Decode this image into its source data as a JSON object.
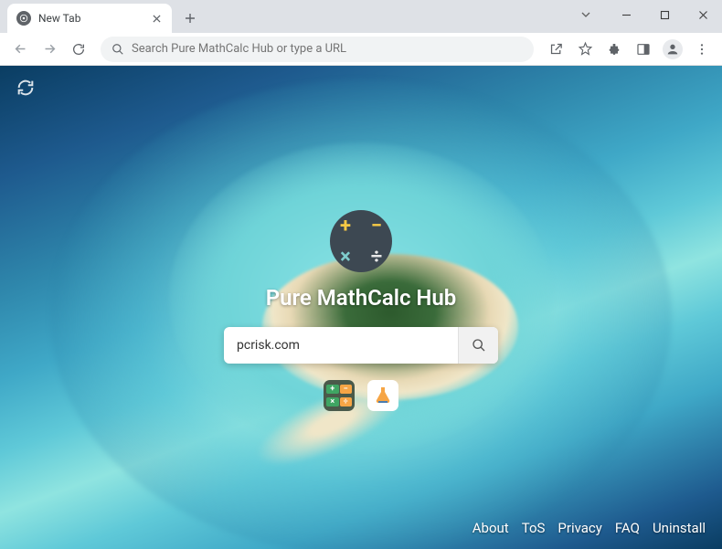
{
  "window": {
    "tab_title": "New Tab"
  },
  "omnibox": {
    "placeholder": "Search Pure MathCalc Hub or type a URL"
  },
  "page": {
    "brand": "Pure MathCalc Hub",
    "search_value": "pcrisk.com",
    "logo_symbols": {
      "plus": "+",
      "minus": "−",
      "times": "×",
      "div": "÷"
    }
  },
  "footer": {
    "links": [
      "About",
      "ToS",
      "Privacy",
      "FAQ",
      "Uninstall"
    ]
  }
}
